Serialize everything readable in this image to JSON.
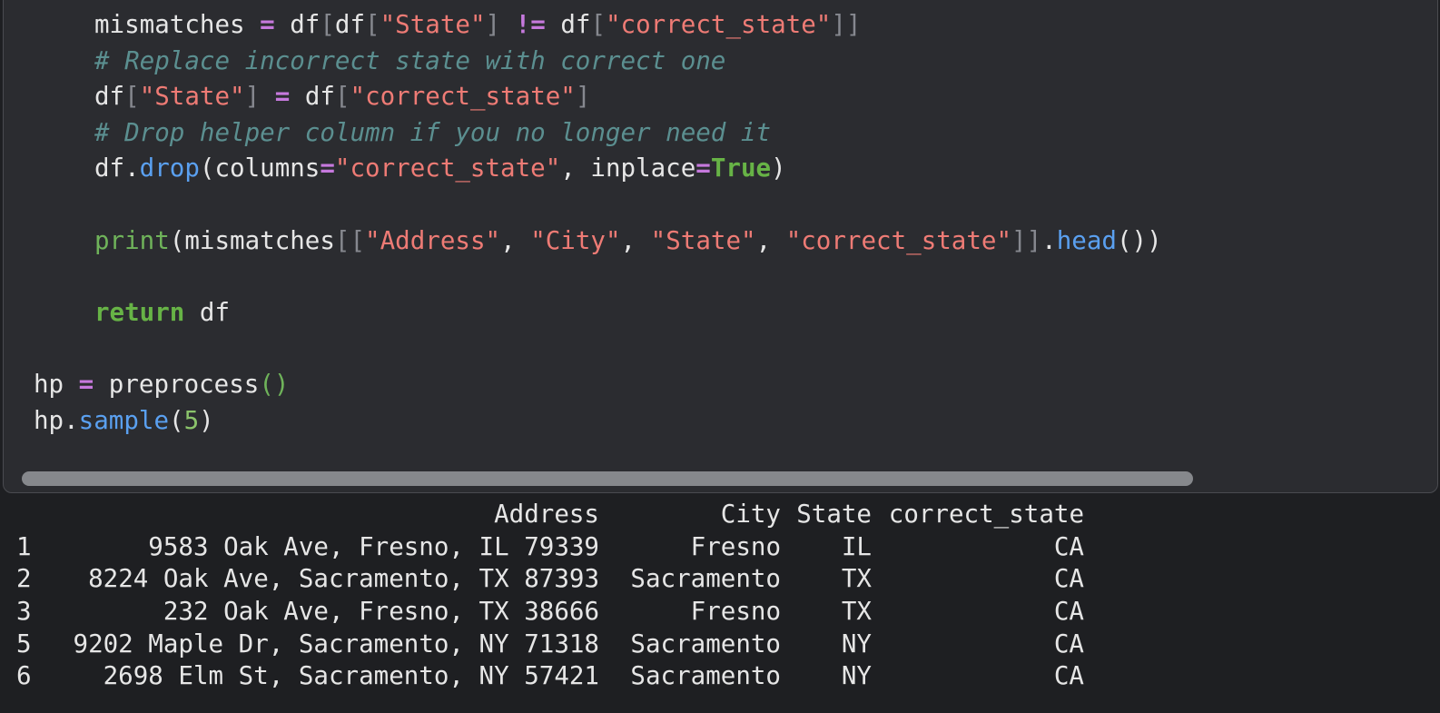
{
  "code": {
    "lines": [
      {
        "indent": 100,
        "tokens": [
          {
            "t": "mismatches ",
            "c": "tx"
          },
          {
            "t": "=",
            "c": "op"
          },
          {
            "t": " df",
            "c": "tx"
          },
          {
            "t": "[",
            "c": "br"
          },
          {
            "t": "df",
            "c": "tx"
          },
          {
            "t": "[",
            "c": "br"
          },
          {
            "t": "\"State\"",
            "c": "str"
          },
          {
            "t": "]",
            "c": "br"
          },
          {
            "t": " ",
            "c": "tx"
          },
          {
            "t": "!=",
            "c": "op"
          },
          {
            "t": " df",
            "c": "tx"
          },
          {
            "t": "[",
            "c": "br"
          },
          {
            "t": "\"correct_state\"",
            "c": "str"
          },
          {
            "t": "]]",
            "c": "br"
          }
        ]
      },
      {
        "indent": 100,
        "tokens": [
          {
            "t": "# Replace incorrect state with correct one",
            "c": "cm"
          }
        ]
      },
      {
        "indent": 100,
        "tokens": [
          {
            "t": "df",
            "c": "tx"
          },
          {
            "t": "[",
            "c": "br"
          },
          {
            "t": "\"State\"",
            "c": "str"
          },
          {
            "t": "]",
            "c": "br"
          },
          {
            "t": " ",
            "c": "tx"
          },
          {
            "t": "=",
            "c": "op"
          },
          {
            "t": " df",
            "c": "tx"
          },
          {
            "t": "[",
            "c": "br"
          },
          {
            "t": "\"correct_state\"",
            "c": "str"
          },
          {
            "t": "]",
            "c": "br"
          }
        ]
      },
      {
        "indent": 100,
        "tokens": [
          {
            "t": "# Drop helper column if you no longer need it",
            "c": "cm"
          }
        ]
      },
      {
        "indent": 100,
        "tokens": [
          {
            "t": "df.",
            "c": "tx"
          },
          {
            "t": "drop",
            "c": "fn"
          },
          {
            "t": "(columns",
            "c": "tx"
          },
          {
            "t": "=",
            "c": "op"
          },
          {
            "t": "\"correct_state\"",
            "c": "str"
          },
          {
            "t": ", inplace",
            "c": "tx"
          },
          {
            "t": "=",
            "c": "op"
          },
          {
            "t": "True",
            "c": "kw"
          },
          {
            "t": ")",
            "c": "tx"
          }
        ]
      },
      {
        "indent": 100,
        "tokens": []
      },
      {
        "indent": 100,
        "tokens": [
          {
            "t": "print",
            "c": "bi"
          },
          {
            "t": "(mismatches",
            "c": "tx"
          },
          {
            "t": "[[",
            "c": "br"
          },
          {
            "t": "\"Address\"",
            "c": "str"
          },
          {
            "t": ", ",
            "c": "tx"
          },
          {
            "t": "\"City\"",
            "c": "str"
          },
          {
            "t": ", ",
            "c": "tx"
          },
          {
            "t": "\"State\"",
            "c": "str"
          },
          {
            "t": ", ",
            "c": "tx"
          },
          {
            "t": "\"correct_state\"",
            "c": "str"
          },
          {
            "t": "]]",
            "c": "br"
          },
          {
            "t": ".",
            "c": "tx"
          },
          {
            "t": "head",
            "c": "fn"
          },
          {
            "t": "())",
            "c": "tx"
          }
        ]
      },
      {
        "indent": 100,
        "tokens": []
      },
      {
        "indent": 100,
        "tokens": [
          {
            "t": "return",
            "c": "kw"
          },
          {
            "t": " df",
            "c": "tx"
          }
        ]
      },
      {
        "indent": 33,
        "tokens": []
      },
      {
        "indent": 33,
        "tokens": [
          {
            "t": "hp ",
            "c": "tx"
          },
          {
            "t": "=",
            "c": "op"
          },
          {
            "t": " preprocess",
            "c": "tx"
          },
          {
            "t": "()",
            "c": "bi"
          }
        ]
      },
      {
        "indent": 33,
        "tokens": [
          {
            "t": "hp.",
            "c": "tx"
          },
          {
            "t": "sample",
            "c": "fn"
          },
          {
            "t": "(",
            "c": "tx"
          },
          {
            "t": "5",
            "c": "num"
          },
          {
            "t": ")",
            "c": "tx"
          }
        ]
      }
    ]
  },
  "output": {
    "header": {
      "idx": "",
      "address": "Address",
      "city": "City",
      "state": "State",
      "correct_state": "correct_state"
    },
    "rows": [
      {
        "idx": "1",
        "address": "9583 Oak Ave, Fresno, IL 79339",
        "city": "Fresno",
        "state": "IL",
        "correct_state": "CA"
      },
      {
        "idx": "2",
        "address": "8224 Oak Ave, Sacramento, TX 87393",
        "city": "Sacramento",
        "state": "TX",
        "correct_state": "CA"
      },
      {
        "idx": "3",
        "address": "232 Oak Ave, Fresno, TX 38666",
        "city": "Fresno",
        "state": "TX",
        "correct_state": "CA"
      },
      {
        "idx": "5",
        "address": "9202 Maple Dr, Sacramento, NY 71318",
        "city": "Sacramento",
        "state": "NY",
        "correct_state": "CA"
      },
      {
        "idx": "6",
        "address": "2698 Elm St, Sacramento, NY 57421",
        "city": "Sacramento",
        "state": "NY",
        "correct_state": "CA"
      }
    ]
  }
}
